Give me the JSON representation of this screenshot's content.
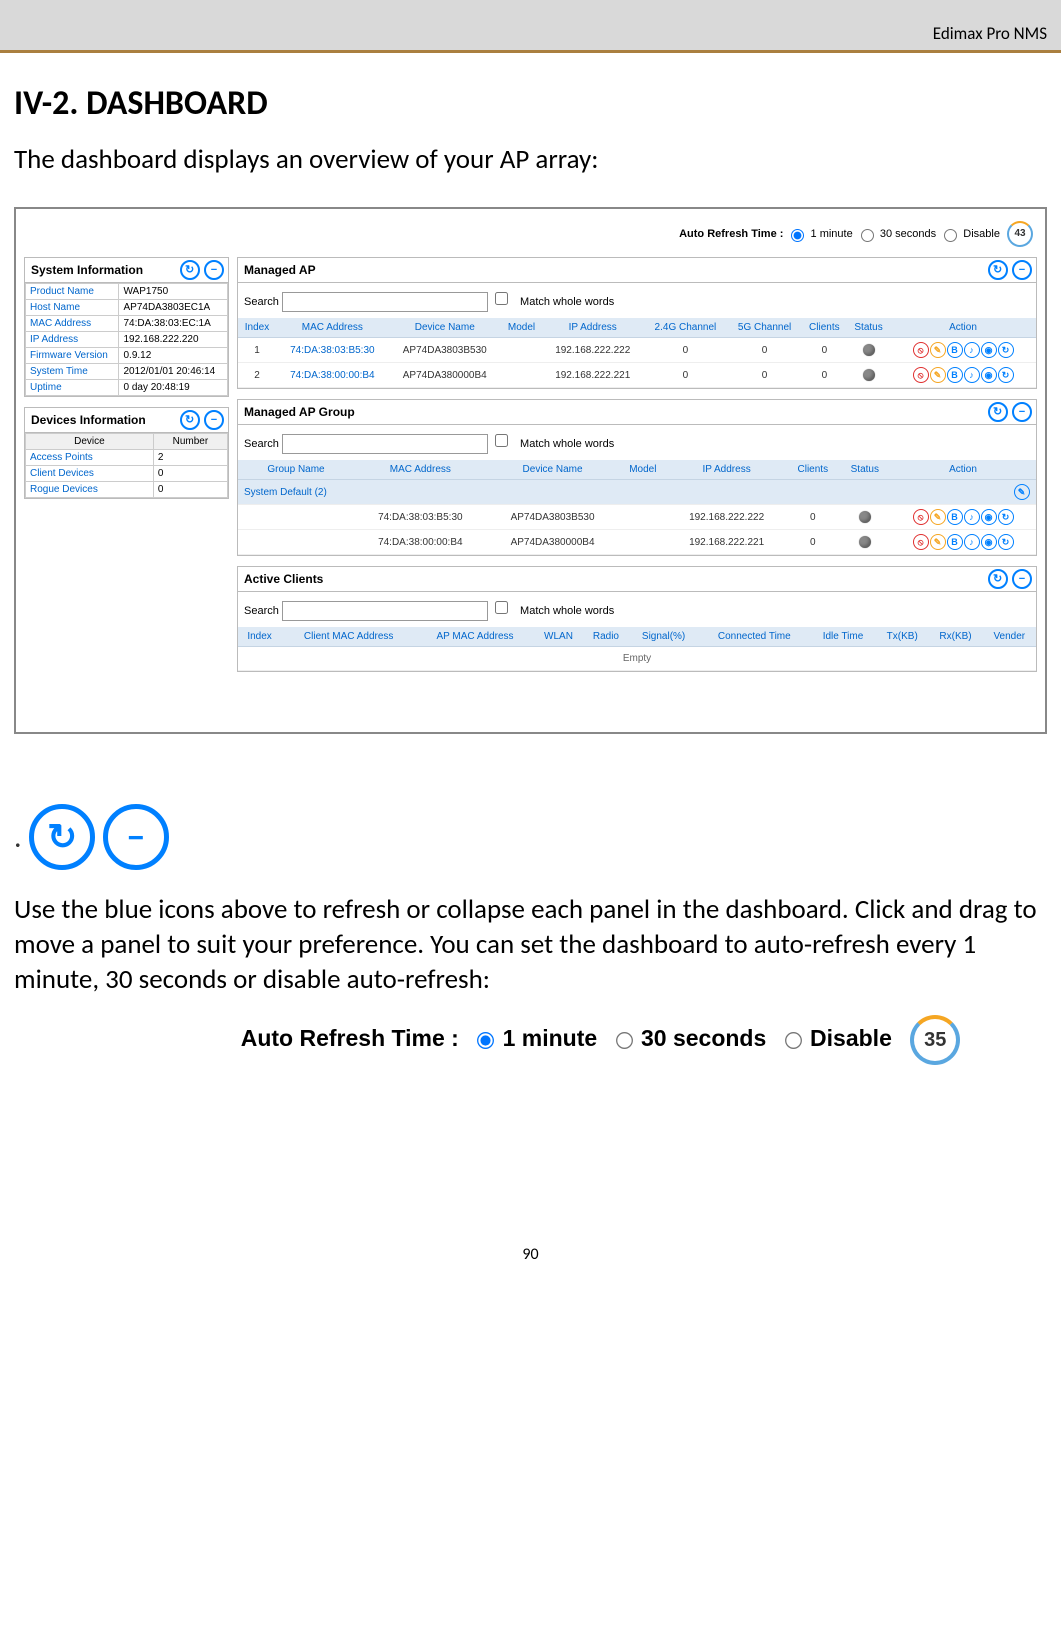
{
  "header_right": "Edimax Pro NMS",
  "section_title": "IV-2. DASHBOARD",
  "intro_text": "The dashboard displays an overview of your AP array:",
  "auto_refresh": {
    "label": "Auto Refresh Time :",
    "opt1": "1 minute",
    "opt2": "30 seconds",
    "opt3": "Disable",
    "counter_screenshot": "43",
    "counter_fig": "35"
  },
  "panels": {
    "sys_info": {
      "title": "System Information",
      "rows": [
        {
          "k": "Product Name",
          "v": "WAP1750"
        },
        {
          "k": "Host Name",
          "v": "AP74DA3803EC1A"
        },
        {
          "k": "MAC Address",
          "v": "74:DA:38:03:EC:1A"
        },
        {
          "k": "IP Address",
          "v": "192.168.222.220"
        },
        {
          "k": "Firmware Version",
          "v": "0.9.12"
        },
        {
          "k": "System Time",
          "v": "2012/01/01 20:46:14"
        },
        {
          "k": "Uptime",
          "v": "0 day 20:48:19"
        }
      ]
    },
    "dev_info": {
      "title": "Devices Information",
      "headers": {
        "c1": "Device",
        "c2": "Number"
      },
      "rows": [
        {
          "k": "Access Points",
          "v": "2"
        },
        {
          "k": "Client Devices",
          "v": "0"
        },
        {
          "k": "Rogue Devices",
          "v": "0"
        }
      ]
    },
    "managed_ap": {
      "title": "Managed AP",
      "search_label": "Search",
      "match_label": "Match whole words",
      "headers": {
        "idx": "Index",
        "mac": "MAC Address",
        "dev": "Device Name",
        "model": "Model",
        "ip": "IP Address",
        "g24": "2.4G Channel",
        "g5": "5G Channel",
        "clients": "Clients",
        "status": "Status",
        "action": "Action"
      },
      "rows": [
        {
          "idx": "1",
          "mac": "74:DA:38:03:B5:30",
          "dev": "AP74DA3803B530",
          "model": "",
          "ip": "192.168.222.222",
          "g24": "0",
          "g5": "0",
          "clients": "0"
        },
        {
          "idx": "2",
          "mac": "74:DA:38:00:00:B4",
          "dev": "AP74DA380000B4",
          "model": "",
          "ip": "192.168.222.221",
          "g24": "0",
          "g5": "0",
          "clients": "0"
        }
      ]
    },
    "managed_ap_group": {
      "title": "Managed AP Group",
      "search_label": "Search",
      "match_label": "Match whole words",
      "headers": {
        "group": "Group Name",
        "mac": "MAC Address",
        "dev": "Device Name",
        "model": "Model",
        "ip": "IP Address",
        "clients": "Clients",
        "status": "Status",
        "action": "Action"
      },
      "group_row": "System Default (2)",
      "rows": [
        {
          "mac": "74:DA:38:03:B5:30",
          "dev": "AP74DA3803B530",
          "model": "",
          "ip": "192.168.222.222",
          "clients": "0"
        },
        {
          "mac": "74:DA:38:00:00:B4",
          "dev": "AP74DA380000B4",
          "model": "",
          "ip": "192.168.222.221",
          "clients": "0"
        }
      ]
    },
    "active_clients": {
      "title": "Active Clients",
      "search_label": "Search",
      "match_label": "Match whole words",
      "headers": {
        "idx": "Index",
        "cmac": "Client MAC Address",
        "apmac": "AP MAC Address",
        "wlan": "WLAN",
        "radio": "Radio",
        "signal": "Signal(%)",
        "ctime": "Connected Time",
        "idle": "Idle Time",
        "tx": "Tx(KB)",
        "rx": "Rx(KB)",
        "vendor": "Vender"
      },
      "empty": "Empty"
    }
  },
  "body_text": "Use the blue icons above to refresh or collapse each panel in the dashboard. Click and drag to move a panel to suit your preference. You can set the dashboard to auto-refresh every 1 minute, 30 seconds or disable auto-refresh:",
  "page_number": "90"
}
